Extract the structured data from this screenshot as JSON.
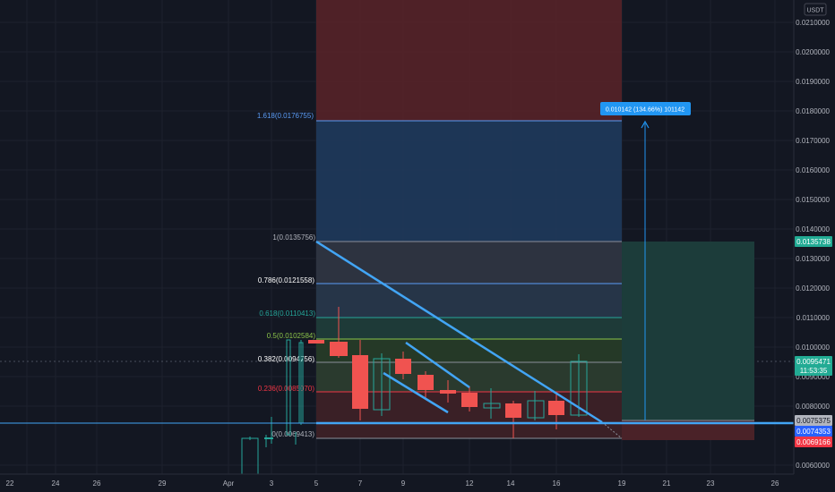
{
  "currency": "USDT",
  "y_ticks": [
    "0.0210000",
    "0.0200000",
    "0.0190000",
    "0.0180000",
    "0.0170000",
    "0.0160000",
    "0.0150000",
    "0.0140000",
    "0.0130000",
    "0.0120000",
    "0.0110000",
    "0.0100000",
    "0.0090000",
    "0.0080000",
    "0.0060000"
  ],
  "x_ticks": [
    "22",
    "24",
    "26",
    "29",
    "Apr",
    "3",
    "5",
    "7",
    "9",
    "12",
    "14",
    "16",
    "19",
    "21",
    "23",
    "26"
  ],
  "fib_levels": [
    {
      "label": "1.618(0.0176755)",
      "color": "#5b9cf6"
    },
    {
      "label": "1(0.0135756)",
      "color": "#b2b5be"
    },
    {
      "label": "0.786(0.0121558)",
      "color": "#ffffff"
    },
    {
      "label": "0.618(0.0110413)",
      "color": "#26a69a"
    },
    {
      "label": "0.5(0.0102584)",
      "color": "#8bc34a"
    },
    {
      "label": "0.382(0.0094756)",
      "color": "#ffffff"
    },
    {
      "label": "0.236(0.0085070)",
      "color": "#f23645"
    },
    {
      "label": "0(0.0069413)",
      "color": "#b2b5be"
    }
  ],
  "measure_label": "0.010142 (134.66%) 101142",
  "price_tags": [
    {
      "text": "0.0135738",
      "bg": "#22ab94",
      "fg": "#ffffff"
    },
    {
      "text": "0.0095471",
      "bg": "#22ab94",
      "fg": "#ffffff"
    },
    {
      "text": "11:53:35",
      "bg": "#22ab94",
      "fg": "#ffffff"
    },
    {
      "text": "0.0075375",
      "bg": "#b2b5be",
      "fg": "#131722"
    },
    {
      "text": "0.0074353",
      "bg": "#2962ff",
      "fg": "#ffffff"
    },
    {
      "text": "0.0069166",
      "bg": "#f23645",
      "fg": "#ffffff"
    }
  ],
  "colors": {
    "bg": "#131722",
    "up": "#26a69a",
    "down": "#f05350",
    "trend": "#42a5f5"
  }
}
